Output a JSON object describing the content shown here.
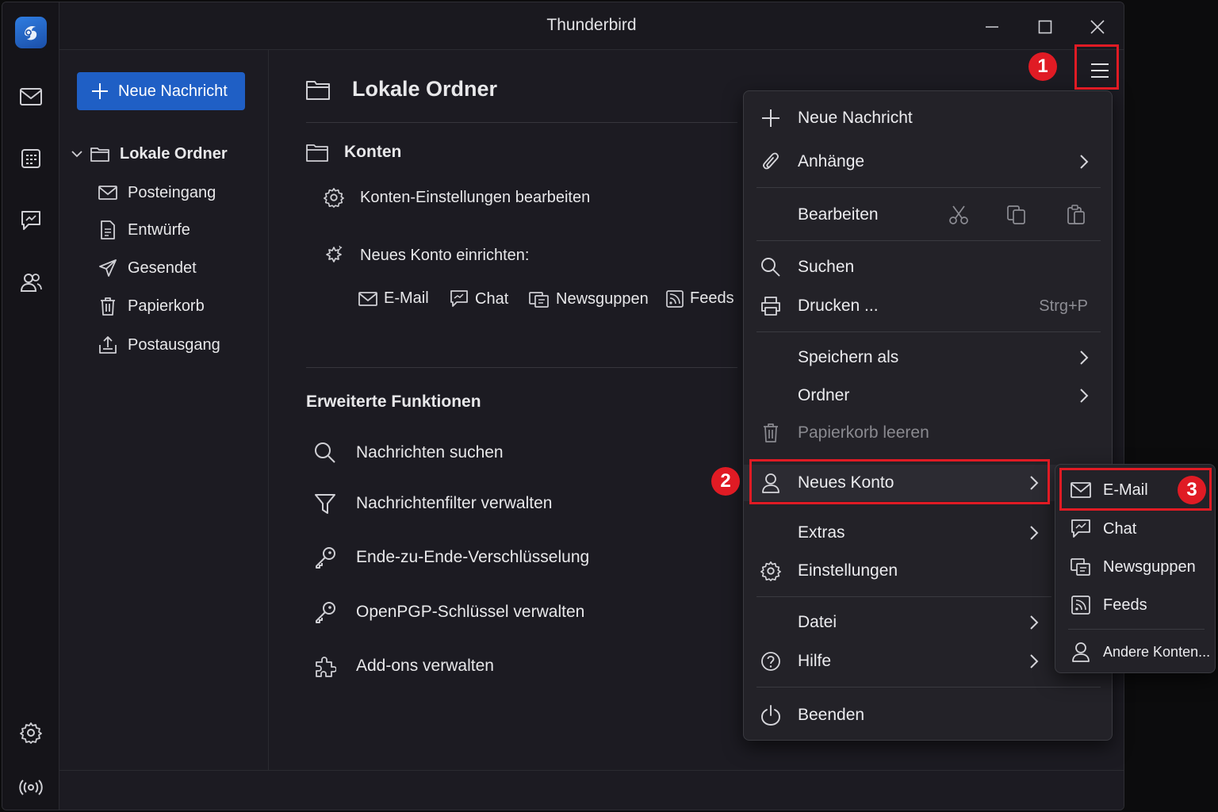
{
  "window": {
    "title": "Thunderbird"
  },
  "spaces": {
    "items": [
      "mail-icon",
      "calendar-icon",
      "chat-icon",
      "address-book-icon"
    ],
    "bottom": [
      "settings-icon",
      "activity-icon"
    ]
  },
  "folder_pane": {
    "new_message_label": "Neue Nachricht",
    "account_label": "Lokale Ordner",
    "folders": [
      {
        "label": "Posteingang",
        "icon": "inbox-icon"
      },
      {
        "label": "Entwürfe",
        "icon": "drafts-icon"
      },
      {
        "label": "Gesendet",
        "icon": "sent-icon"
      },
      {
        "label": "Papierkorb",
        "icon": "trash-icon"
      },
      {
        "label": "Postausgang",
        "icon": "outbox-icon"
      }
    ]
  },
  "account_central": {
    "title": "Lokale Ordner",
    "accounts_heading": "Konten",
    "edit_settings": "Konten-Einstellungen bearbeiten",
    "setup_new": "Neues Konto einrichten:",
    "setup_types": [
      "E-Mail",
      "Chat",
      "Newsguppen",
      "Feeds"
    ],
    "advanced_heading": "Erweiterte Funktionen",
    "advanced_items": [
      "Nachrichten suchen",
      "Nachrichtenfilter verwalten",
      "Ende-zu-Ende-Verschlüsselung",
      "OpenPGP-Schlüssel verwalten",
      "Add-ons verwalten"
    ]
  },
  "app_menu": {
    "new_message": "Neue Nachricht",
    "attachments": "Anhänge",
    "edit": "Bearbeiten",
    "search": "Suchen",
    "print": "Drucken ...",
    "print_shortcut": "Strg+P",
    "save_as": "Speichern als",
    "folder": "Ordner",
    "empty_trash": "Papierkorb leeren",
    "new_account": "Neues Konto",
    "extras": "Extras",
    "settings": "Einstellungen",
    "file": "Datei",
    "help": "Hilfe",
    "quit": "Beenden"
  },
  "submenu": {
    "email": "E-Mail",
    "chat": "Chat",
    "newsgroups": "Newsguppen",
    "feeds": "Feeds",
    "other": "Andere Konten..."
  },
  "annotations": {
    "badge1": "1",
    "badge2": "2",
    "badge3": "3",
    "color": "#e01b24"
  },
  "colors": {
    "accent": "#1f5fc5",
    "background": "#1c1b22"
  }
}
